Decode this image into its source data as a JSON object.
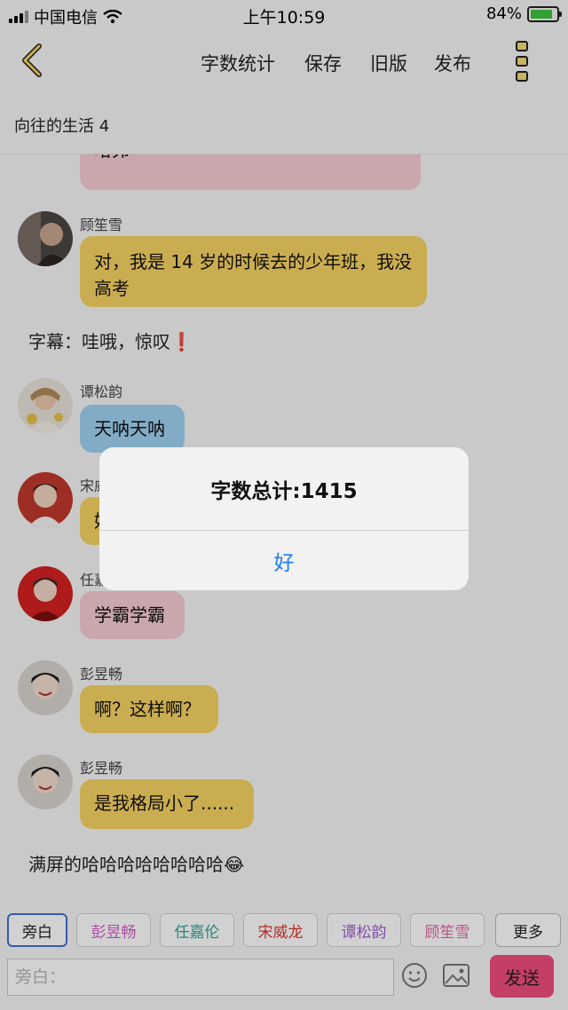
{
  "status_bar": {
    "carrier": "中国电信",
    "time": "上午10:59",
    "battery": "84%",
    "battery_level": 0.84
  },
  "navbar": {
    "word_count": "字数统计",
    "save": "保存",
    "old_version": "旧版",
    "publish": "发布"
  },
  "page_title": "向往的生活 4",
  "messages": [
    {
      "text": "哈弗",
      "color": "#f7cbd4"
    },
    {
      "user": "顾笙雪",
      "text": "对，我是 14 岁的时候去的少年班，我没高考",
      "color": "#f8d463"
    },
    {
      "caption": "字幕：哇哦，惊叹",
      "mark": "❗"
    },
    {
      "user": "谭松韵",
      "text": "天呐天呐",
      "color": "#9fd2f2"
    },
    {
      "user": "宋威龙",
      "text": "好",
      "color": "#f8d463"
    },
    {
      "user": "任嘉伦",
      "text": "学霸学霸",
      "color": "#f7cbd4"
    },
    {
      "user": "彭昱畅",
      "text": "啊？这样啊？",
      "color": "#f8d463"
    },
    {
      "user": "彭昱畅",
      "text": "是我格局小了......",
      "color": "#f8d463"
    },
    {
      "caption": "满屏的哈哈哈哈哈哈哈哈",
      "mark": "😂"
    }
  ],
  "role_tags": [
    {
      "label": "旁白",
      "color": "#222222"
    },
    {
      "label": "彭昱畅",
      "color": "#d15dc8"
    },
    {
      "label": "任嘉伦",
      "color": "#2aa795"
    },
    {
      "label": "宋威龙",
      "color": "#d9372f"
    },
    {
      "label": "谭松韵",
      "color": "#a261cf"
    },
    {
      "label": "顾笙雪",
      "color": "#e06aa5"
    },
    {
      "label": "更多",
      "color": "#222222"
    }
  ],
  "input": {
    "placeholder": "旁白："
  },
  "send": "发送",
  "dialog": {
    "message": "字数总计:1415",
    "ok": "好"
  }
}
